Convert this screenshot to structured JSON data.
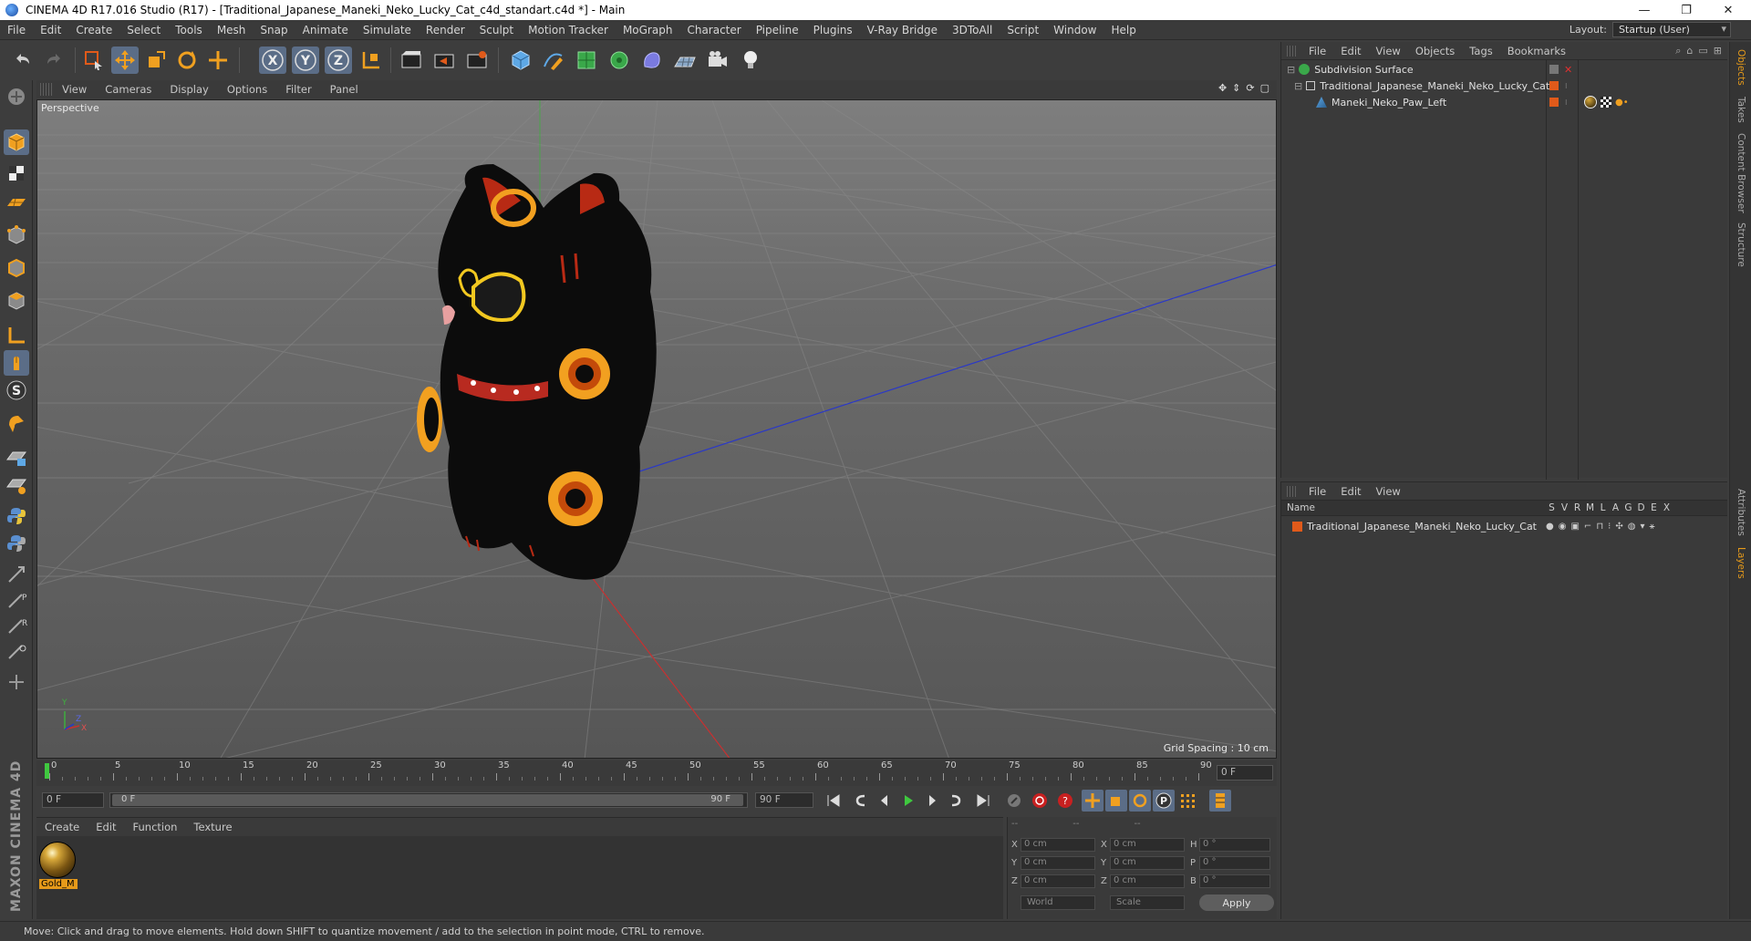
{
  "window": {
    "title": "CINEMA 4D R17.016 Studio (R17) - [Traditional_Japanese_Maneki_Neko_Lucky_Cat_c4d_standart.c4d *] - Main",
    "minimize": "—",
    "maximize": "❐",
    "close": "✕"
  },
  "menubar": {
    "items": [
      "File",
      "Edit",
      "Create",
      "Select",
      "Tools",
      "Mesh",
      "Snap",
      "Animate",
      "Simulate",
      "Render",
      "Sculpt",
      "Motion Tracker",
      "MoGraph",
      "Character",
      "Pipeline",
      "Plugins",
      "V-Ray Bridge",
      "3DToAll",
      "Script",
      "Window",
      "Help"
    ],
    "layout_label": "Layout:",
    "layout_value": "Startup (User)"
  },
  "toolbar": {
    "icons": [
      "undo-icon",
      "redo-icon",
      "live-selection-icon",
      "move-icon",
      "scale-icon",
      "rotate-icon",
      "last-tool-icon",
      "x-axis-icon",
      "y-axis-icon",
      "z-axis-icon",
      "coordinate-system-icon",
      "render-view-icon",
      "render-picture-viewer-icon",
      "edit-render-settings-icon",
      "cube-icon",
      "spline-pen-icon",
      "subdivision-surface-icon",
      "cloner-icon",
      "deformer-icon",
      "floor-icon",
      "camera-icon",
      "light-icon"
    ]
  },
  "viewport": {
    "menu": [
      "View",
      "Cameras",
      "Display",
      "Options",
      "Filter",
      "Panel"
    ],
    "label": "Perspective",
    "grid_spacing": "Grid Spacing : 10 cm",
    "axis_y": "Y",
    "axis_z": "Z",
    "axis_x": "X"
  },
  "timeline": {
    "ticks": [
      "0",
      "5",
      "10",
      "15",
      "20",
      "25",
      "30",
      "35",
      "40",
      "45",
      "50",
      "55",
      "60",
      "65",
      "70",
      "75",
      "80",
      "85",
      "90"
    ],
    "current_frame": "0 F",
    "start_frame": "0 F",
    "slider_start": "0 F",
    "slider_end": "90 F",
    "end_frame": "90 F"
  },
  "material_manager": {
    "menu": [
      "Create",
      "Edit",
      "Function",
      "Texture"
    ],
    "materials": [
      {
        "name": "Gold_M"
      }
    ]
  },
  "coordinates": {
    "header_1": "--",
    "header_2": "--",
    "header_3": "--",
    "rows": [
      {
        "a_label": "X",
        "a_val": "0 cm",
        "b_label": "X",
        "b_val": "0 cm",
        "c_label": "H",
        "c_val": "0 °"
      },
      {
        "a_label": "Y",
        "a_val": "0 cm",
        "b_label": "Y",
        "b_val": "0 cm",
        "c_label": "P",
        "c_val": "0 °"
      },
      {
        "a_label": "Z",
        "a_val": "0 cm",
        "b_label": "Z",
        "b_val": "0 cm",
        "c_label": "B",
        "c_val": "0 °"
      }
    ],
    "space_dropdown": "World",
    "mode_dropdown": "Scale",
    "apply": "Apply"
  },
  "object_manager": {
    "menu": [
      "File",
      "Edit",
      "View",
      "Objects",
      "Tags",
      "Bookmarks"
    ],
    "objects": [
      {
        "name": "Subdivision Surface"
      },
      {
        "name": "Traditional_Japanese_Maneki_Neko_Lucky_Cat"
      },
      {
        "name": "Maneki_Neko_Paw_Left"
      }
    ]
  },
  "layer_manager": {
    "menu": [
      "File",
      "Edit",
      "View"
    ],
    "columns": [
      "Name",
      "S",
      "V",
      "R",
      "M",
      "L",
      "A",
      "G",
      "D",
      "E",
      "X"
    ],
    "layers": [
      {
        "name": "Traditional_Japanese_Maneki_Neko_Lucky_Cat"
      }
    ]
  },
  "right_tabs": [
    "Objects",
    "Takes",
    "Content Browser",
    "Structure",
    "Attributes",
    "Layers"
  ],
  "statusbar": {
    "text": "Move: Click and drag to move elements. Hold down SHIFT to quantize movement / add to the selection in point mode, CTRL to remove."
  },
  "branding": {
    "logo_text": "MAXON CINEMA 4D"
  },
  "colors": {
    "accent": "#e69a1a",
    "active_tool": "#5b6d87",
    "panel": "#3a3a3a",
    "cat_body": "#101010",
    "cat_spots": "#f08a12"
  }
}
